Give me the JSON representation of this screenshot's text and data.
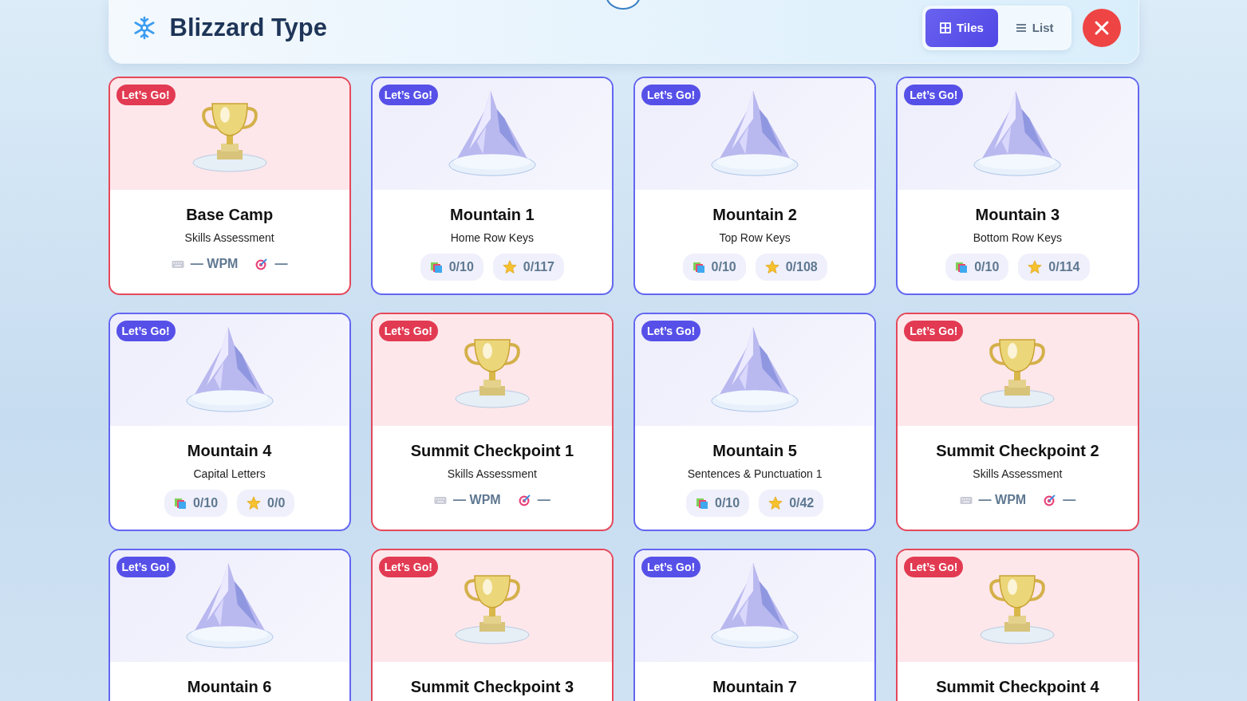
{
  "app": {
    "title": "Blizzard Type"
  },
  "view_toggle": [
    {
      "kind": "tiles",
      "label": "Tiles",
      "selected": true
    },
    {
      "kind": "list",
      "label": "List",
      "selected": false
    }
  ],
  "levels": [
    {
      "kind": "checkpoint",
      "badge": "Let’s Go!",
      "title": "Base Camp",
      "subtitle": "Skills Assessment",
      "wpm": "— WPM",
      "accuracy": "—"
    },
    {
      "kind": "mountain",
      "badge": "Let’s Go!",
      "title": "Mountain 1",
      "subtitle": "Home Row Keys",
      "lessons": "0/10",
      "star_score": "0/117"
    },
    {
      "kind": "mountain",
      "badge": "Let’s Go!",
      "title": "Mountain 2",
      "subtitle": "Top Row Keys",
      "lessons": "0/10",
      "star_score": "0/108"
    },
    {
      "kind": "mountain",
      "badge": "Let’s Go!",
      "title": "Mountain 3",
      "subtitle": "Bottom Row Keys",
      "lessons": "0/10",
      "star_score": "0/114"
    },
    {
      "kind": "mountain",
      "badge": "Let’s Go!",
      "title": "Mountain 4",
      "subtitle": "Capital Letters",
      "lessons": "0/10",
      "star_score": "0/0"
    },
    {
      "kind": "checkpoint",
      "badge": "Let’s Go!",
      "title": "Summit Checkpoint 1",
      "subtitle": "Skills Assessment",
      "wpm": "— WPM",
      "accuracy": "—"
    },
    {
      "kind": "mountain",
      "badge": "Let’s Go!",
      "title": "Mountain 5",
      "subtitle": "Sentences & Punctuation 1",
      "lessons": "0/10",
      "star_score": "0/42"
    },
    {
      "kind": "checkpoint",
      "badge": "Let’s Go!",
      "title": "Summit Checkpoint 2",
      "subtitle": "Skills Assessment",
      "wpm": "— WPM",
      "accuracy": "—"
    },
    {
      "kind": "mountain",
      "badge": "Let’s Go!",
      "title": "Mountain 6"
    },
    {
      "kind": "checkpoint",
      "badge": "Let’s Go!",
      "title": "Summit Checkpoint 3"
    },
    {
      "kind": "mountain",
      "badge": "Let’s Go!",
      "title": "Mountain 7"
    },
    {
      "kind": "checkpoint",
      "badge": "Let’s Go!",
      "title": "Summit Checkpoint 4"
    }
  ]
}
